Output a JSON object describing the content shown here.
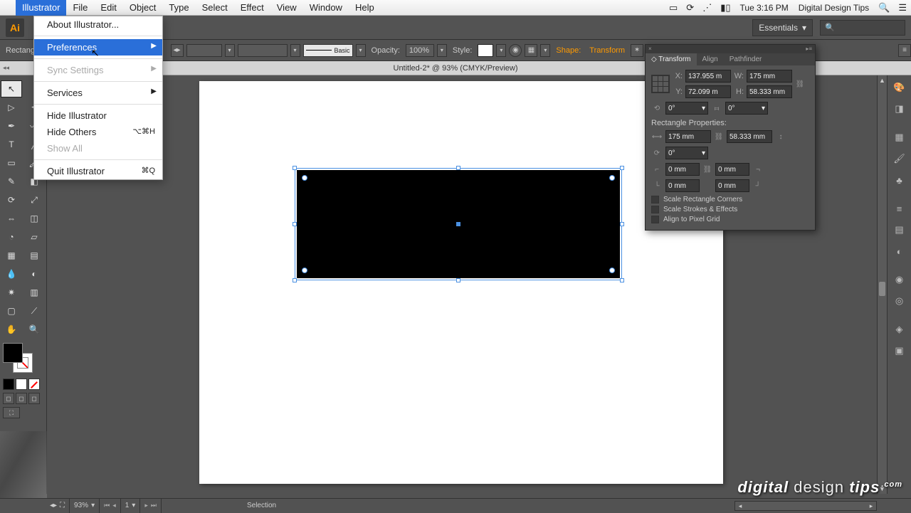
{
  "mac_menu": {
    "app": "Illustrator",
    "items": [
      "File",
      "Edit",
      "Object",
      "Type",
      "Select",
      "Effect",
      "View",
      "Window",
      "Help"
    ],
    "right": {
      "time": "Tue 3:16 PM",
      "user": "Digital Design Tips"
    }
  },
  "dropdown": {
    "about": "About Illustrator...",
    "preferences": "Preferences",
    "sync": "Sync Settings",
    "services": "Services",
    "hide": "Hide Illustrator",
    "hide_others": "Hide Others",
    "hide_others_key": "⌥⌘H",
    "show_all": "Show All",
    "quit": "Quit Illustrator",
    "quit_key": "⌘Q"
  },
  "app_bar": {
    "workspace": "Essentials"
  },
  "opt_bar": {
    "tool": "Rectangle",
    "stroke_style": "Basic",
    "opacity_label": "Opacity:",
    "opacity": "100%",
    "style_label": "Style:",
    "shape_label": "Shape:",
    "transform_label": "Transform"
  },
  "doc_tab": "Untitled-2* @ 93% (CMYK/Preview)",
  "panel": {
    "tabs": [
      "Transform",
      "Align",
      "Pathfinder"
    ],
    "x": "137.955 m",
    "y": "72.099 m",
    "w": "175 mm",
    "h": "58.333 mm",
    "rot": "0°",
    "shear": "0°",
    "rect_title": "Rectangle Properties:",
    "rw": "175 mm",
    "rh": "58.333 mm",
    "ra": "0°",
    "c_tl": "0 mm",
    "c_tr": "0 mm",
    "c_bl": "0 mm",
    "c_br": "0 mm",
    "cb1": "Scale Rectangle Corners",
    "cb2": "Scale Strokes & Effects",
    "cb3": "Align to Pixel Grid"
  },
  "status": {
    "zoom": "93%",
    "artboard": "1",
    "mode": "Selection"
  },
  "watermark": {
    "a": "digital",
    "b": "design",
    "c": "tips",
    "d": ".com"
  }
}
